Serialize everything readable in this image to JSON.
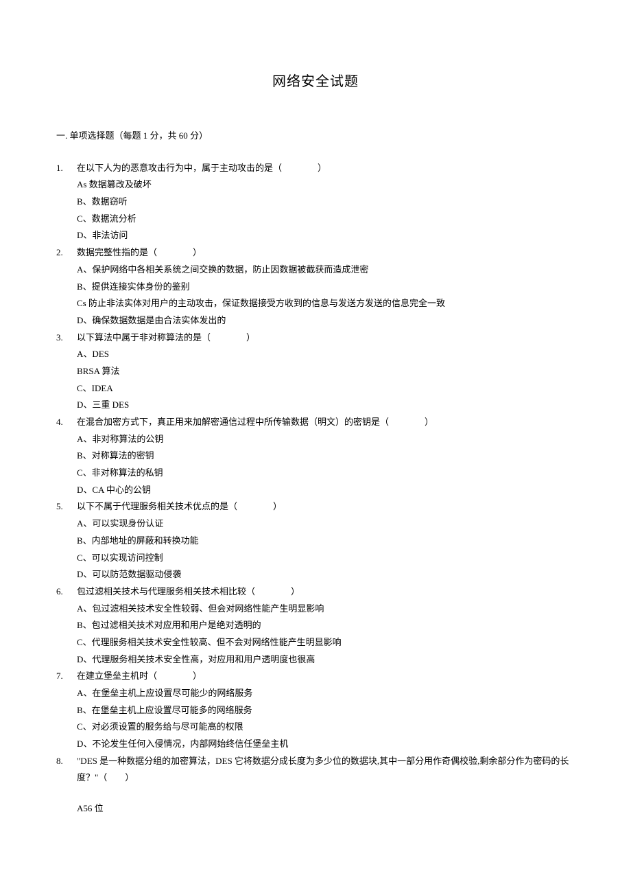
{
  "title": "网络安全试题",
  "section_header": "一. 单项选择题（每题 1 分，共 60 分）",
  "questions": [
    {
      "num": "1.",
      "stem": "在以下人为的恶意攻击行为中，属于主动攻击的是（　　　　）",
      "options": [
        "As 数据篡改及破坏",
        "B、数据窃听",
        "C、数据流分析",
        "D、非法访问"
      ]
    },
    {
      "num": "2.",
      "stem": "数据完整性指的是（　　　　）",
      "options": [
        "A、保护网络中各相关系统之间交换的数据，防止因数据被截获而造成泄密",
        "B、提供连接实体身份的鉴别",
        "Cs 防止非法实体对用户的主动攻击，保证数据接受方收到的信息与发送方发送的信息完全一致",
        "D、确保数据数据是由合法实体发出的"
      ]
    },
    {
      "num": "3.",
      "stem": "以下算法中属于非对称算法的是（　　　　）",
      "options": [
        "A、DES",
        "BRSA 算法",
        "C、IDEA",
        "D、三重 DES"
      ]
    },
    {
      "num": "4.",
      "stem": "在混合加密方式下，真正用来加解密通信过程中所传输数据（明文）的密钥是（　　　　）",
      "options": [
        "A、非对称算法的公钥",
        "B、对称算法的密钥",
        "C、非对称算法的私钥",
        "D、CA 中心的公钥"
      ]
    },
    {
      "num": "5.",
      "stem": "以下不属于代理服务相关技术优点的是（　　　　）",
      "options": [
        "A、可以实现身份认证",
        "B、内部地址的屏蔽和转换功能",
        "C、可以实现访问控制",
        "D、可以防范数据驱动侵袭"
      ]
    },
    {
      "num": "6.",
      "stem": "包过滤相关技术与代理服务相关技术相比较（　　　　）",
      "options": [
        "A、包过滤相关技术安全性较弱、但会对网络性能产生明显影响",
        "B、包过滤相关技术对应用和用户是绝对透明的",
        "C、代理服务相关技术安全性较高、但不会对网络性能产生明显影响",
        "D、代理服务相关技术安全性高，对应用和用户透明度也很高"
      ]
    },
    {
      "num": "7.",
      "stem": "在建立堡垒主机时（　　　　）",
      "options": [
        "A、在堡垒主机上应设置尽可能少的网络服务",
        "B、在堡垒主机上应设置尽可能多的网络服务",
        "C、对必须设置的服务给与尽可能高的权限",
        "D、不论发生任何入侵情况，内部网始终信任堡垒主机"
      ]
    },
    {
      "num": "8.",
      "stem": "\"DES 是一种数据分组的加密算法，DES 它将数据分成长度为多少位的数据块,其中一部分用作奇偶校验,剩余部分作为密码的长度？\"（　　）",
      "spacer_after": true,
      "options": [
        "A56 位"
      ]
    }
  ]
}
